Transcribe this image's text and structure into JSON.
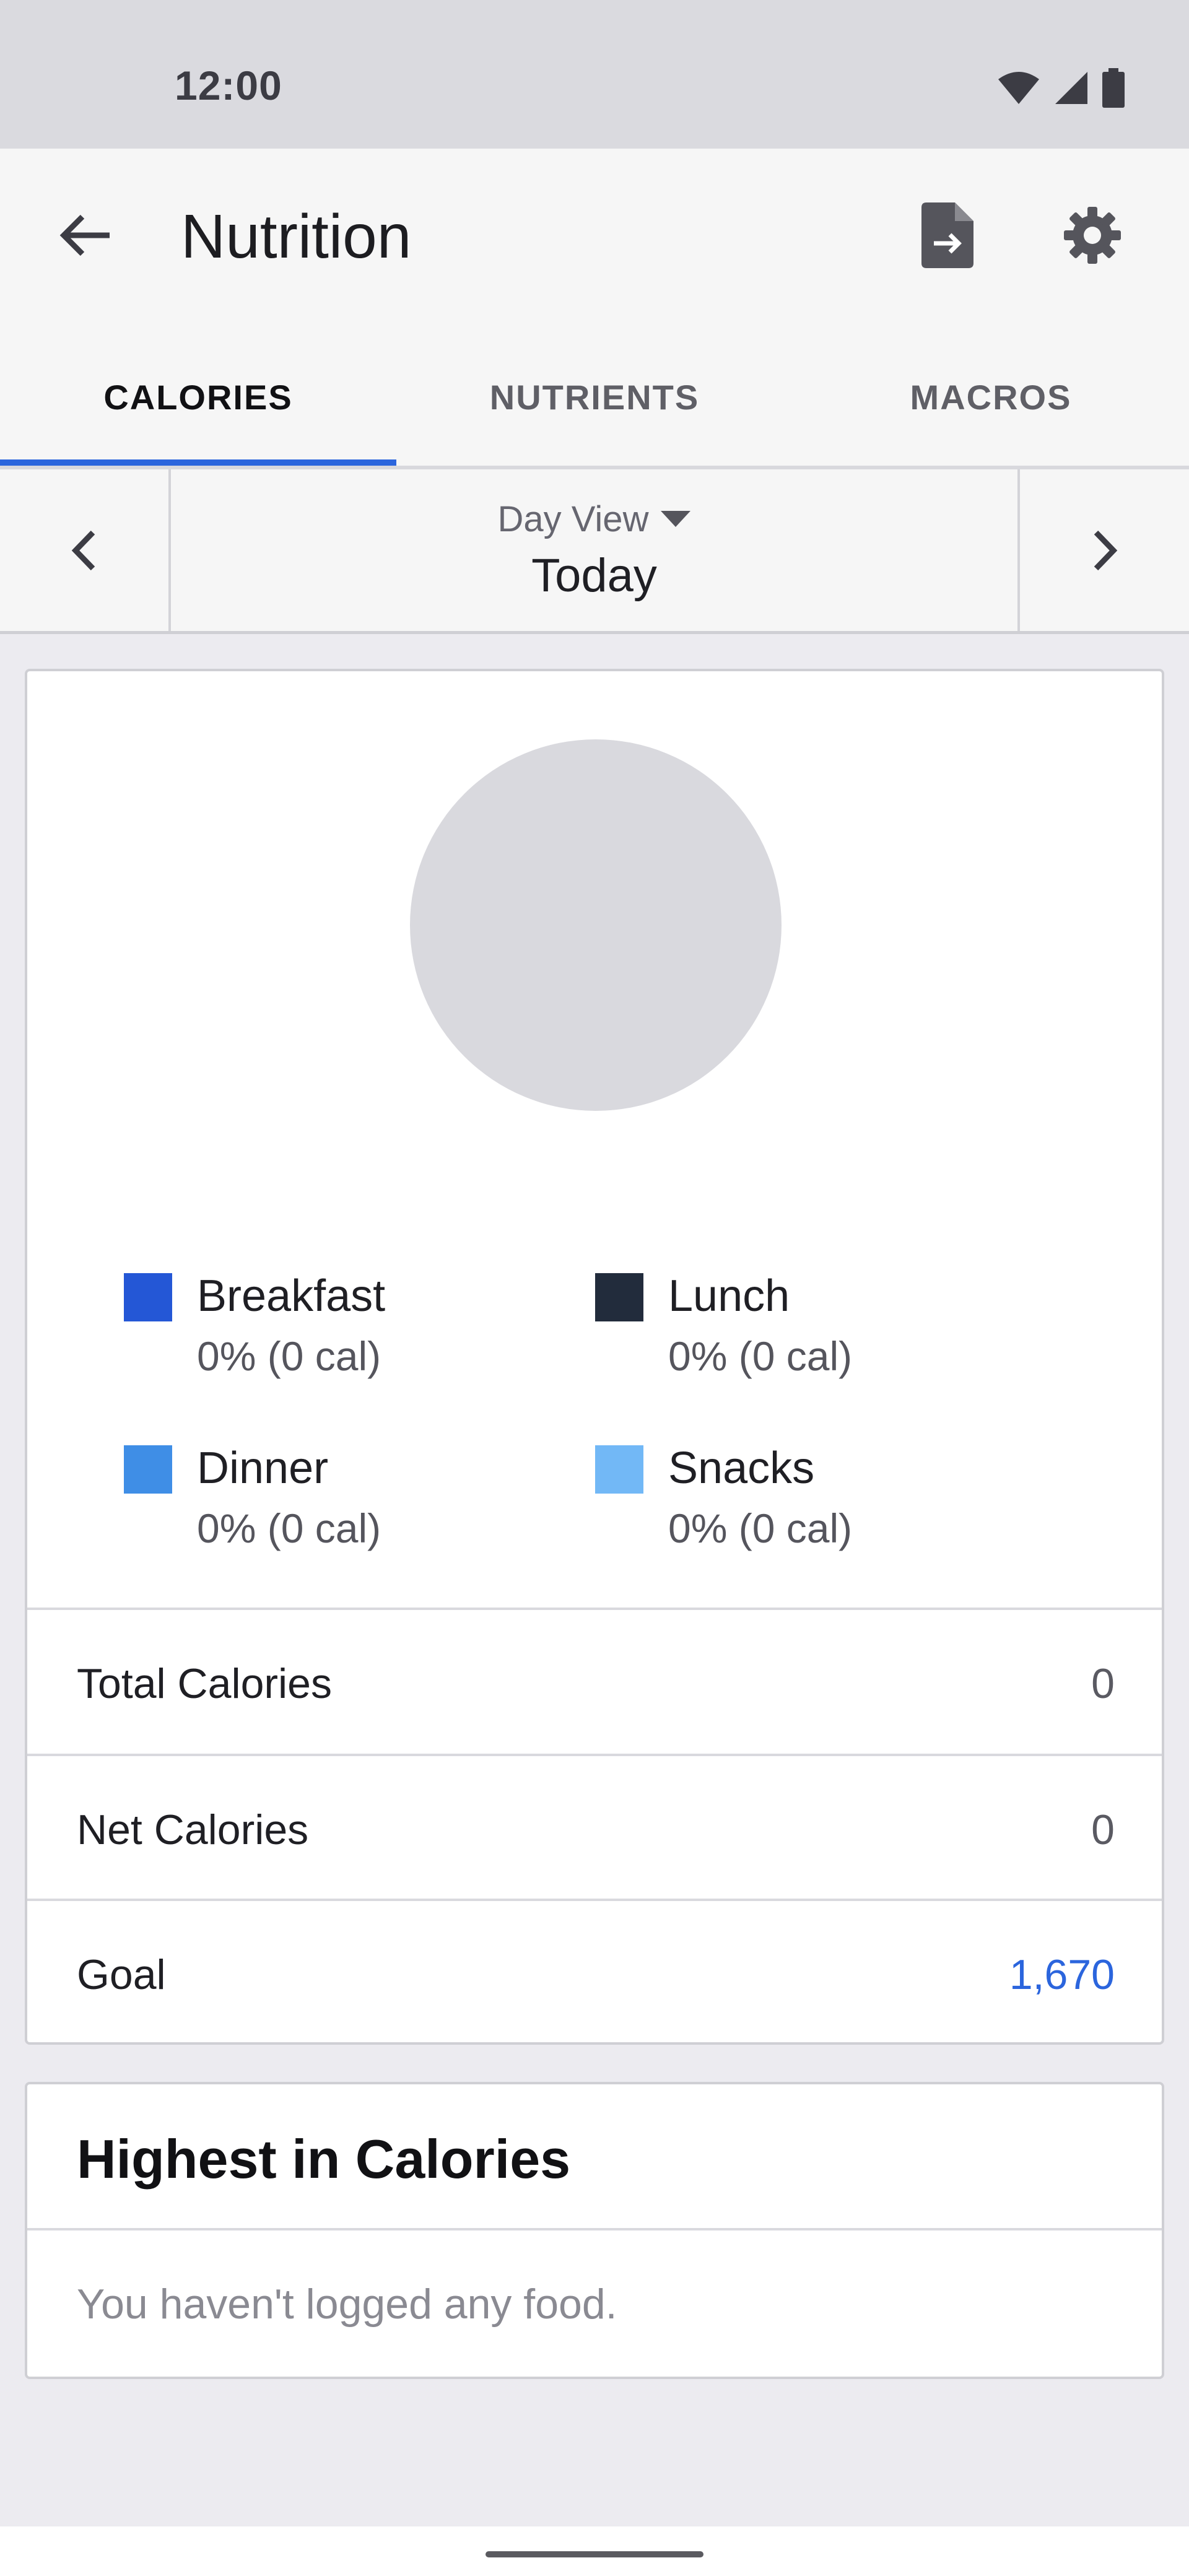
{
  "status_bar": {
    "time": "12:00",
    "icons": [
      "wifi-icon",
      "signal-icon",
      "battery-icon"
    ]
  },
  "app_bar": {
    "title": "Nutrition",
    "back_icon": "arrow-back-icon",
    "export_icon": "file-export-icon",
    "settings_icon": "gear-icon"
  },
  "tabs": [
    {
      "label": "CALORIES",
      "active": true
    },
    {
      "label": "NUTRIENTS",
      "active": false
    },
    {
      "label": "MACROS",
      "active": false
    }
  ],
  "date_nav": {
    "view_label": "Day View",
    "date": "Today"
  },
  "calories_chart": {
    "empty_color": "#d9d9de"
  },
  "legend": [
    {
      "name": "Breakfast",
      "value": "0% (0 cal)",
      "color": "#2457d6"
    },
    {
      "name": "Lunch",
      "value": "0% (0 cal)",
      "color": "#222c3c"
    },
    {
      "name": "Dinner",
      "value": "0% (0 cal)",
      "color": "#3f8ee6"
    },
    {
      "name": "Snacks",
      "value": "0% (0 cal)",
      "color": "#72b8f6"
    }
  ],
  "summary": [
    {
      "label": "Total Calories",
      "value": "0"
    },
    {
      "label": "Net Calories",
      "value": "0"
    },
    {
      "label": "Goal",
      "value": "1,670"
    }
  ],
  "highest": {
    "title": "Highest in Calories",
    "empty_message": "You haven't logged any food."
  },
  "colors": {
    "accent": "#2b65dd"
  }
}
